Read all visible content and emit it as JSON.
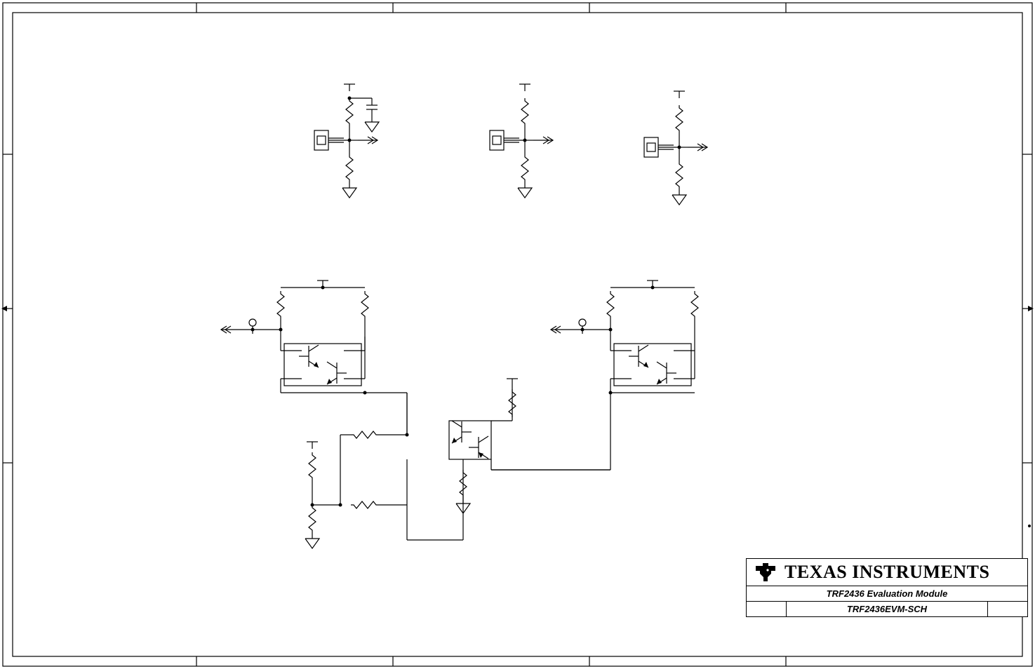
{
  "title_block": {
    "brand": "TEXAS INSTRUMENTS",
    "line1": "TRF2436 Evaluation Module",
    "line2": "TRF2436EVM-SCH"
  },
  "schematic": {
    "description": "Schematic sheet with three RF connector input stages (top row) and two differential transistor pair stages driven by a current mirror (bottom), drawn as a black-line block diagram on a standard drawing frame.",
    "icons": [
      "rf-connector",
      "resistor",
      "capacitor",
      "ground-symbol",
      "port-arrow-in",
      "port-arrow-out",
      "bjt-npn",
      "bjt-pnp",
      "power-rail",
      "node-dot",
      "test-point"
    ]
  }
}
